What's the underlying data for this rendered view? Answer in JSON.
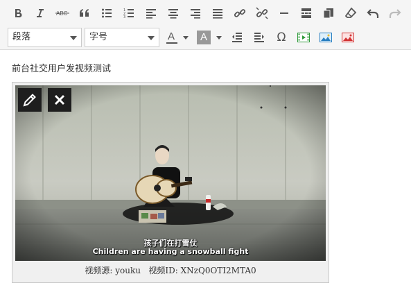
{
  "toolbar": {
    "row1": [
      {
        "name": "bold-button",
        "icon": "bold-icon"
      },
      {
        "name": "italic-button",
        "icon": "italic-icon"
      },
      {
        "name": "strikethrough-button",
        "icon": "strikethrough-icon"
      },
      {
        "name": "blockquote-button",
        "icon": "quote-icon"
      },
      {
        "name": "bullet-list-button",
        "icon": "bullet-list-icon"
      },
      {
        "name": "numbered-list-button",
        "icon": "numbered-list-icon"
      },
      {
        "name": "align-left-button",
        "icon": "align-left-icon"
      },
      {
        "name": "align-center-button",
        "icon": "align-center-icon"
      },
      {
        "name": "align-right-button",
        "icon": "align-right-icon"
      },
      {
        "name": "justify-button",
        "icon": "justify-icon"
      },
      {
        "name": "insert-link-button",
        "icon": "link-icon"
      },
      {
        "name": "remove-link-button",
        "icon": "unlink-icon"
      },
      {
        "name": "horizontal-line-button",
        "icon": "horizontal-line-icon"
      },
      {
        "name": "read-more-button",
        "icon": "read-more-icon"
      },
      {
        "name": "paste-text-button",
        "icon": "paste-icon"
      },
      {
        "name": "clear-format-button",
        "icon": "eraser-icon"
      },
      {
        "name": "undo-button",
        "icon": "undo-icon"
      },
      {
        "name": "redo-button",
        "icon": "redo-icon"
      }
    ],
    "paragraph_select": {
      "value": "段落"
    },
    "fontsize_select": {
      "value": "字号"
    },
    "text_color_label": "A",
    "bg_color_label": "A",
    "special_char_label": "Ω"
  },
  "content": {
    "paragraph": "前台社交用户发视频测试",
    "video": {
      "subtitle_cn": "孩子们在打雪仗",
      "subtitle_en": "Children are having a snowball fight",
      "source_line": "视频源: youku   视频ID: XNzQ0OTI2MTA0"
    }
  },
  "colors": {
    "toolbar_bg": "#f5f5f5",
    "icon": "#555555",
    "overlay_button": "#1e1e1e"
  }
}
